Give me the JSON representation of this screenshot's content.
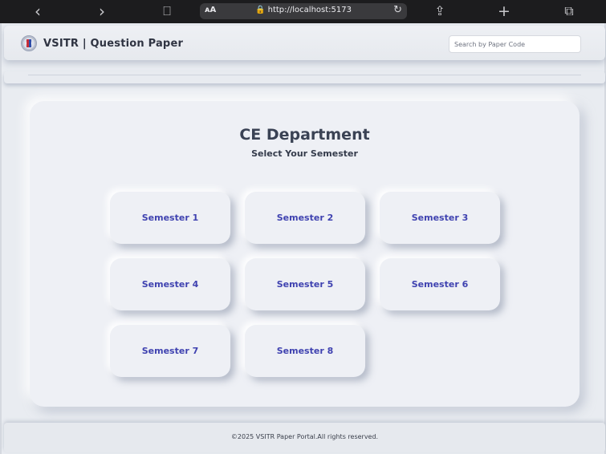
{
  "browser": {
    "back_icon": "chevron-left-icon",
    "forward_icon": "chevron-right-icon",
    "reader_icon": "book-icon",
    "url_aa": "ᴀA",
    "url": "🔒 http://localhost:5173",
    "reload_icon": "reload-icon",
    "share_icon": "share-icon",
    "new_tab_icon": "plus-icon",
    "tabs_icon": "tabs-icon",
    "glyphs": {
      "back": "‹",
      "forward": "›",
      "reader": "⎕",
      "reload": "↻",
      "share": "⇪",
      "plus": "+",
      "tabs": "⧉"
    }
  },
  "navbar": {
    "brand": "VSITR | Question Paper",
    "search_placeholder": "Search by Paper Code"
  },
  "main": {
    "title": "CE Department",
    "subtitle": "Select Your Semester",
    "semesters": [
      "Semester 1",
      "Semester 2",
      "Semester 3",
      "Semester 4",
      "Semester 5",
      "Semester 6",
      "Semester 7",
      "Semester 8"
    ],
    "accent_color": "#3f42b0"
  },
  "footer": {
    "text": "©2025 VSITR Paper Portal.All rights reserved."
  }
}
